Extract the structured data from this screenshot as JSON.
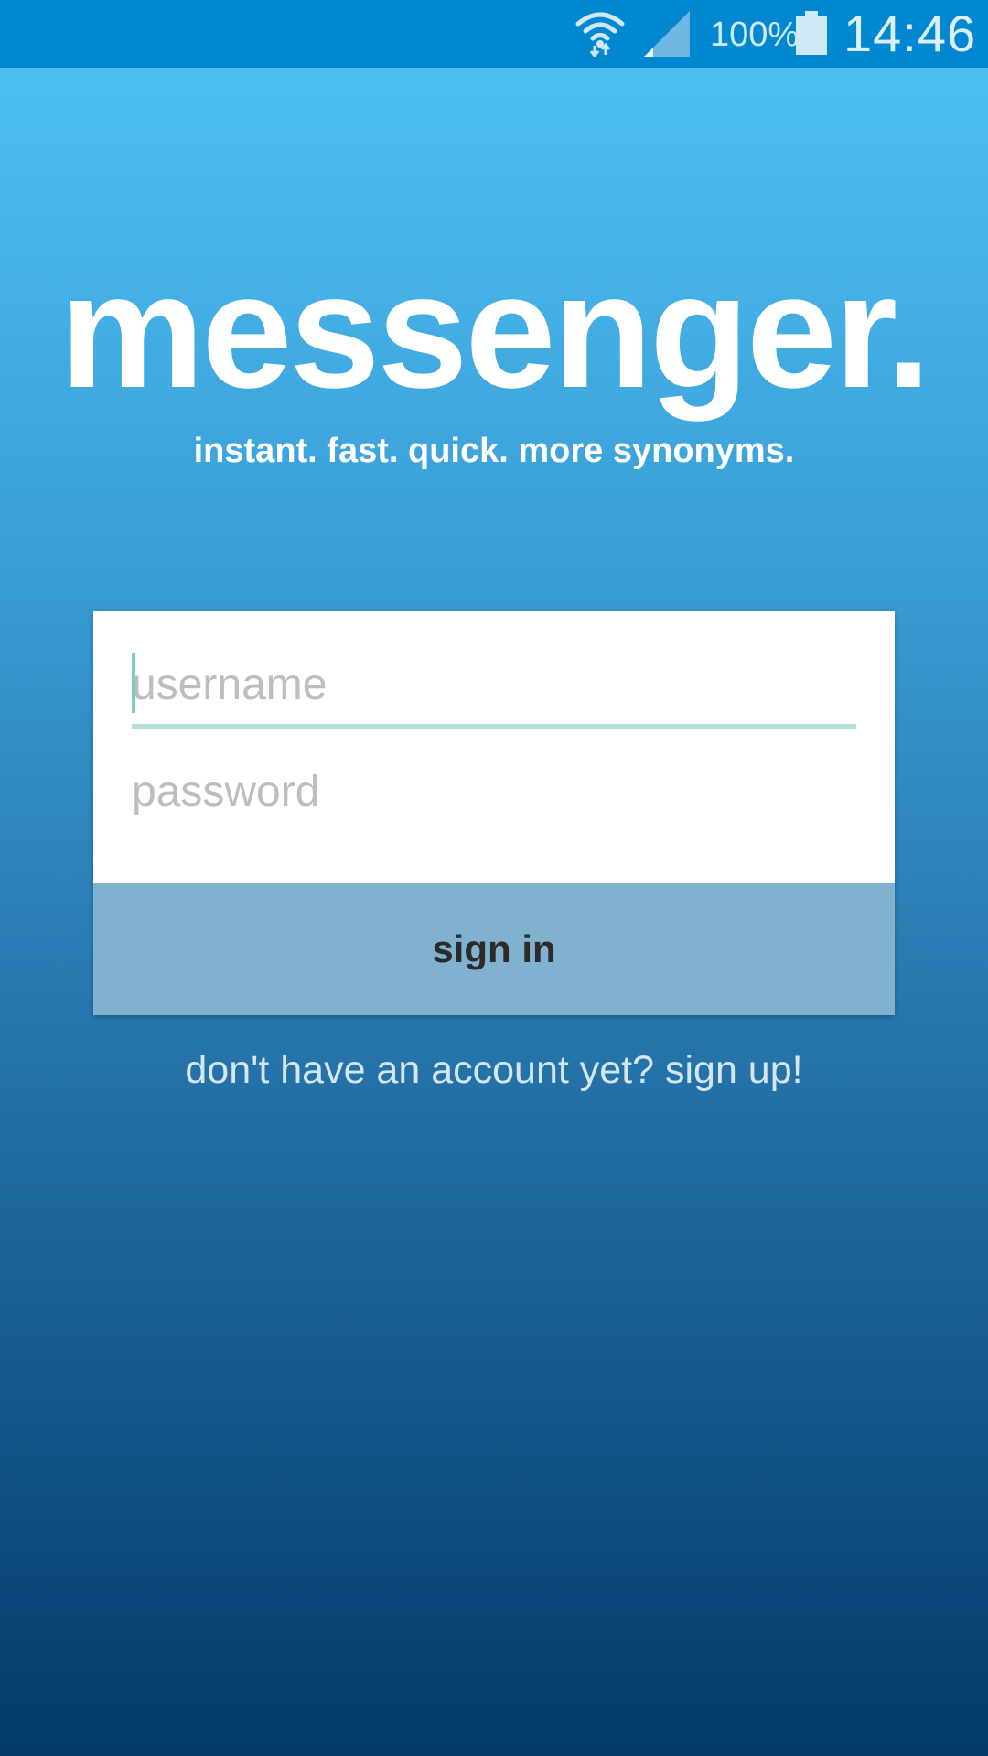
{
  "status_bar": {
    "battery_percent": "100%",
    "time": "14:46",
    "icons": [
      "wifi-icon",
      "cell-signal-icon",
      "battery-icon"
    ]
  },
  "app": {
    "title": "messenger.",
    "tagline": "instant. fast. quick. more synonyms."
  },
  "login_form": {
    "username_placeholder": "username",
    "username_value": "",
    "password_placeholder": "password",
    "password_value": "",
    "sign_in_label": "sign in"
  },
  "signup": {
    "text": "don't have an account yet? sign up!"
  },
  "colors": {
    "status_bar": "#0288d1",
    "gradient_top": "#4fc3f7",
    "gradient_bottom": "#033a68",
    "button": "#80b2cf",
    "focus_underline": "#b2dfdb"
  }
}
